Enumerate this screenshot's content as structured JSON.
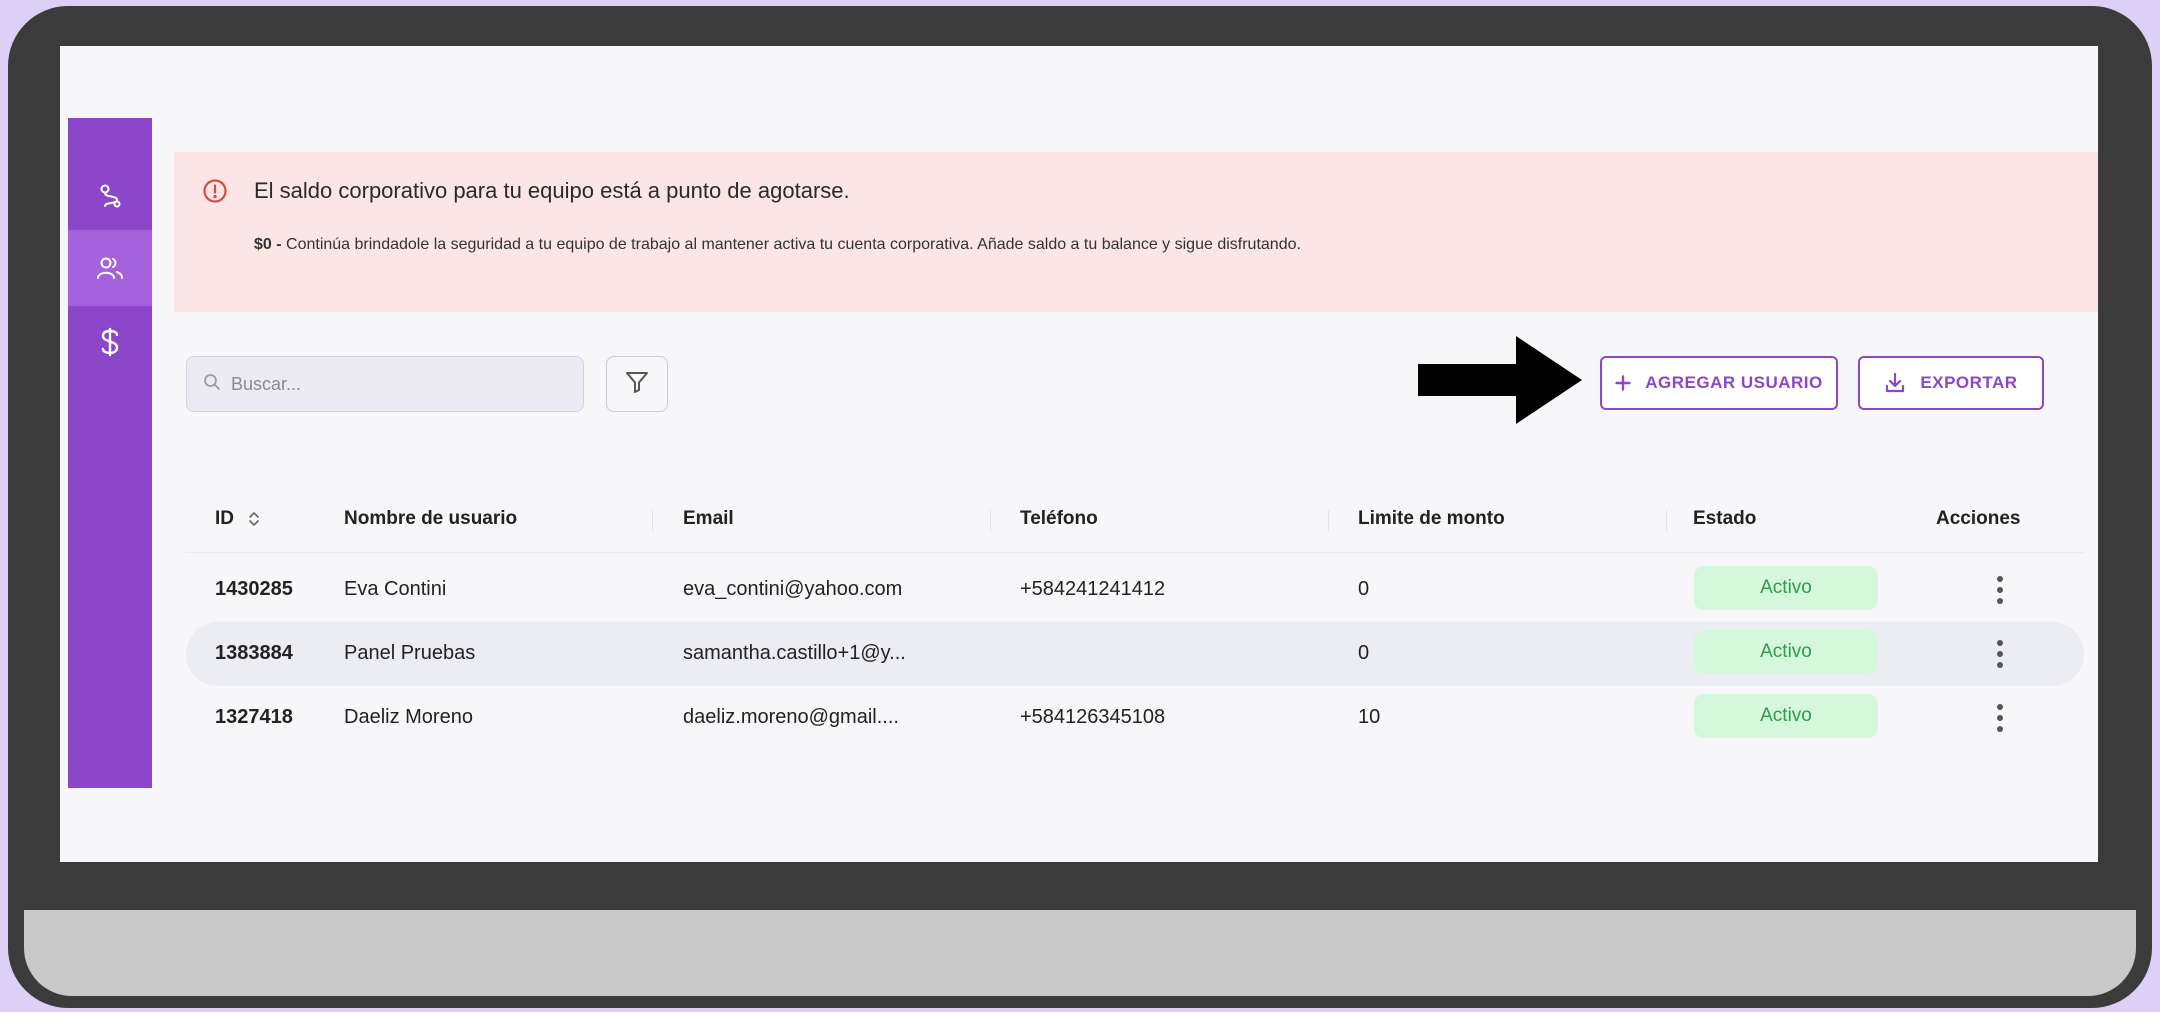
{
  "alert": {
    "title": "El saldo corporativo para tu equipo está a punto de agotarse.",
    "amount": "$0 -",
    "description": " Continúa brindadole la seguridad a tu equipo de trabajo al mantener activa tu cuenta corporativa. Añade saldo a tu balance y sigue disfrutando."
  },
  "sidebar": {
    "items": [
      {
        "icon": "route-icon",
        "active": false
      },
      {
        "icon": "users-icon",
        "active": true
      },
      {
        "icon": "dollar-icon",
        "active": false
      }
    ]
  },
  "toolbar": {
    "search_placeholder": "Buscar...",
    "add_user_label": "AGREGAR USUARIO",
    "export_label": "EXPORTAR"
  },
  "table": {
    "headers": {
      "id": "ID",
      "username": "Nombre de usuario",
      "email": "Email",
      "phone": "Teléfono",
      "limit": "Limite de monto",
      "status": "Estado",
      "actions": "Acciones"
    },
    "rows": [
      {
        "id": "1430285",
        "username": "Eva Contini",
        "email": "eva_contini@yahoo.com",
        "phone": "+584241241412",
        "limit": "0",
        "status": "Activo"
      },
      {
        "id": "1383884",
        "username": "Panel Pruebas",
        "email": "samantha.castillo+1@y...",
        "phone": "",
        "limit": "0",
        "status": "Activo"
      },
      {
        "id": "1327418",
        "username": "Daeliz Moreno",
        "email": "daeliz.moreno@gmail....",
        "phone": "+584126345108",
        "limit": "10",
        "status": "Activo"
      }
    ]
  },
  "colors": {
    "accent": "#8b46c9",
    "alert_bg": "#fbe6e5",
    "alert_icon": "#d84a4a",
    "status_bg": "#d5f7dc",
    "status_text": "#2f9a4f",
    "page_bg": "#ddd0f7"
  }
}
